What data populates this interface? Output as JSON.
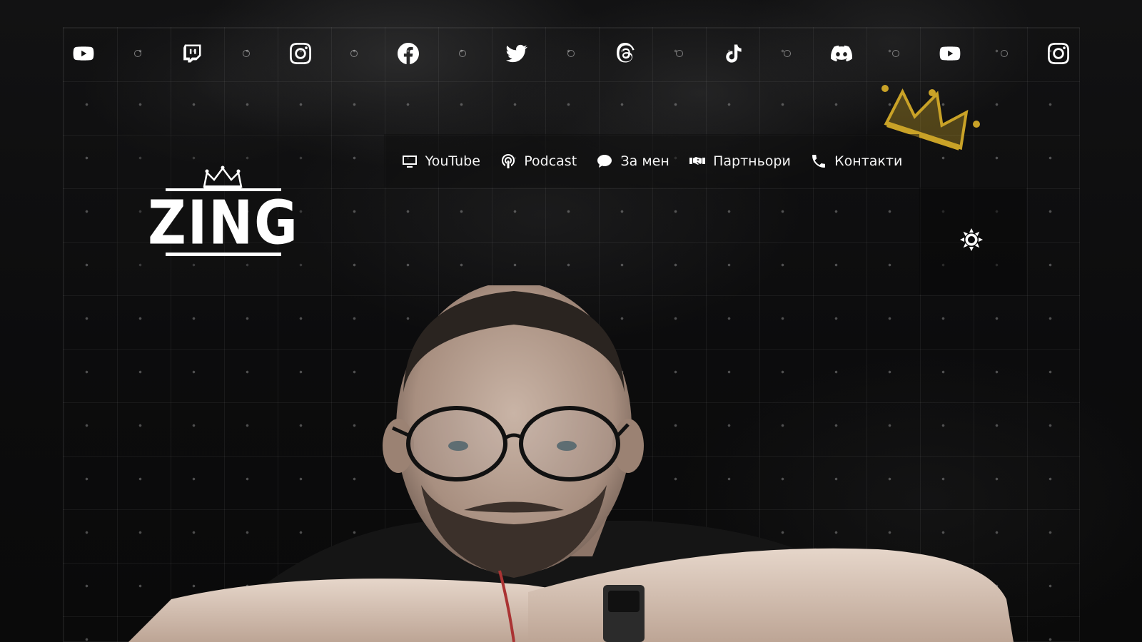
{
  "social_bar": {
    "icons": [
      {
        "name": "youtube-icon",
        "label": "YouTube"
      },
      {
        "name": "twitch-icon",
        "label": "Twitch"
      },
      {
        "name": "instagram-icon",
        "label": "Instagram"
      },
      {
        "name": "facebook-icon",
        "label": "Facebook"
      },
      {
        "name": "twitter-icon",
        "label": "Twitter"
      },
      {
        "name": "threads-icon",
        "label": "Threads"
      },
      {
        "name": "tiktok-icon",
        "label": "TikTok"
      },
      {
        "name": "discord-icon",
        "label": "Discord"
      },
      {
        "name": "youtube-icon",
        "label": "YouTube"
      },
      {
        "name": "instagram-icon",
        "label": "Instagram"
      }
    ]
  },
  "logo": {
    "text": "ZING"
  },
  "nav": {
    "items": [
      {
        "label": "YouTube",
        "icon": "monitor-icon"
      },
      {
        "label": "Podcast",
        "icon": "podcast-icon"
      },
      {
        "label": "За мен",
        "icon": "speech-bubble-icon"
      },
      {
        "label": "Партньори",
        "icon": "handshake-icon"
      },
      {
        "label": "Контакти",
        "icon": "phone-icon"
      }
    ]
  },
  "theme_toggle": {
    "icon": "sun-icon"
  },
  "colors": {
    "background": "#0b0b0c",
    "accent_gold": "#c9a227",
    "text": "#f2f2f2"
  }
}
